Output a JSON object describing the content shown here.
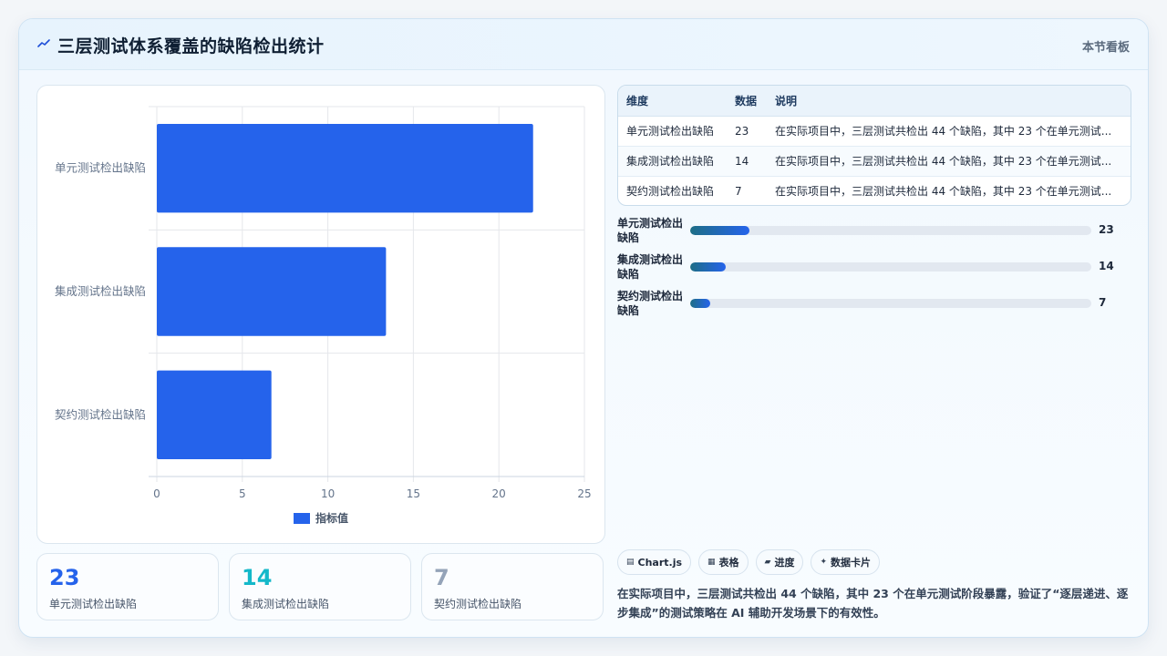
{
  "header": {
    "icon": "trend-line-icon",
    "title": "三层测试体系覆盖的缺陷检出统计",
    "tag": "本节看板"
  },
  "chart_data": {
    "type": "bar",
    "orientation": "horizontal",
    "categories": [
      "单元测试检出缺陷",
      "集成测试检出缺陷",
      "契约测试检出缺陷"
    ],
    "series": [
      {
        "name": "指标值",
        "values": [
          22,
          13.4,
          6.7
        ],
        "color": "#2563eb"
      }
    ],
    "xlim": [
      0,
      25
    ],
    "xticks": [
      "0",
      "5",
      "10",
      "15",
      "20",
      "25"
    ],
    "grid": true,
    "legend": "bottom"
  },
  "table": {
    "headers": [
      "维度",
      "数据",
      "说明"
    ],
    "rows": [
      [
        "单元测试检出缺陷",
        "23",
        "在实际项目中，三层测试共检出 44 个缺陷，其中 23 个在单元测试..."
      ],
      [
        "集成测试检出缺陷",
        "14",
        "在实际项目中，三层测试共检出 44 个缺陷，其中 23 个在单元测试..."
      ],
      [
        "契约测试检出缺陷",
        "7",
        "在实际项目中，三层测试共检出 44 个缺陷，其中 23 个在单元测试..."
      ]
    ]
  },
  "progress": [
    {
      "label": "单元测试检出缺陷",
      "value": "23",
      "fraction": 0.148
    },
    {
      "label": "集成测试检出缺陷",
      "value": "14",
      "fraction": 0.089
    },
    {
      "label": "契约测试检出缺陷",
      "value": "7",
      "fraction": 0.05
    }
  ],
  "stats": [
    {
      "value": "23",
      "label": "单元测试检出缺陷",
      "color": "#2563eb"
    },
    {
      "value": "14",
      "label": "集成测试检出缺陷",
      "color": "#14b8c9"
    },
    {
      "value": "7",
      "label": "契约测试检出缺陷",
      "color": "#94a3b8"
    }
  ],
  "chips": [
    {
      "icon": "chart-icon",
      "glyph": "▤",
      "label": "Chart.js"
    },
    {
      "icon": "table-icon",
      "glyph": "▦",
      "label": "表格"
    },
    {
      "icon": "progress-icon",
      "glyph": "▰",
      "label": "进度"
    },
    {
      "icon": "sparkle-icon",
      "glyph": "✦",
      "label": "数据卡片"
    }
  ],
  "summary": "在实际项目中，三层测试共检出 44 个缺陷，其中 23 个在单元测试阶段暴露，验证了“逐层递进、逐步集成”的测试策略在 AI 辅助开发场景下的有效性。"
}
